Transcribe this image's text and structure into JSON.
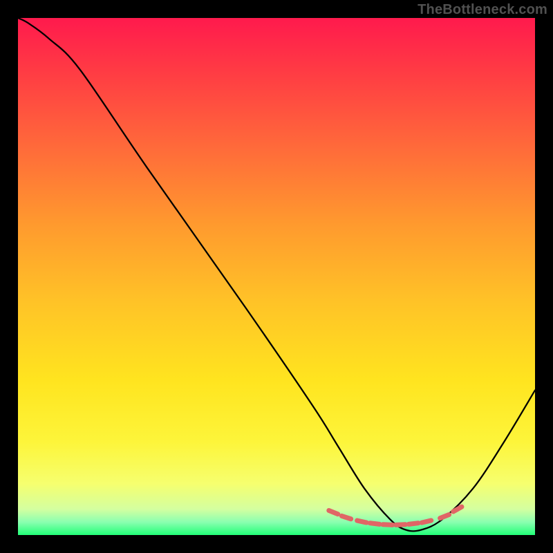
{
  "watermark": "TheBottleneck.com",
  "chart_data": {
    "type": "line",
    "title": "",
    "xlabel": "",
    "ylabel": "",
    "xlim": [
      0,
      100
    ],
    "ylim": [
      0,
      100
    ],
    "gradient_stops": [
      {
        "pos": 0,
        "color": "#ff1a4d"
      },
      {
        "pos": 10,
        "color": "#ff3a44"
      },
      {
        "pos": 25,
        "color": "#ff6a3a"
      },
      {
        "pos": 40,
        "color": "#ff9a2e"
      },
      {
        "pos": 55,
        "color": "#ffc327"
      },
      {
        "pos": 70,
        "color": "#ffe41f"
      },
      {
        "pos": 82,
        "color": "#fdf53a"
      },
      {
        "pos": 90,
        "color": "#f6ff6e"
      },
      {
        "pos": 95,
        "color": "#d4ffa0"
      },
      {
        "pos": 97.5,
        "color": "#8affb0"
      },
      {
        "pos": 100,
        "color": "#22ff77"
      }
    ],
    "series": [
      {
        "name": "bottleneck-curve",
        "x": [
          0,
          2,
          6,
          12,
          25,
          44,
          57,
          62,
          67,
          72,
          75,
          78,
          82,
          88,
          94,
          100
        ],
        "values": [
          100,
          99,
          96,
          90,
          71,
          44,
          25,
          17,
          9,
          3,
          1,
          1,
          3,
          9,
          18,
          28
        ]
      }
    ],
    "markers": {
      "name": "optimal-range-markers",
      "color": "#e06666",
      "x": [
        61,
        63.5,
        66.5,
        69,
        71.5,
        74,
        76.5,
        79,
        82.5,
        85
      ],
      "values": [
        4.4,
        3.4,
        2.6,
        2.2,
        2.0,
        2.0,
        2.2,
        2.6,
        3.6,
        5.0
      ]
    }
  }
}
